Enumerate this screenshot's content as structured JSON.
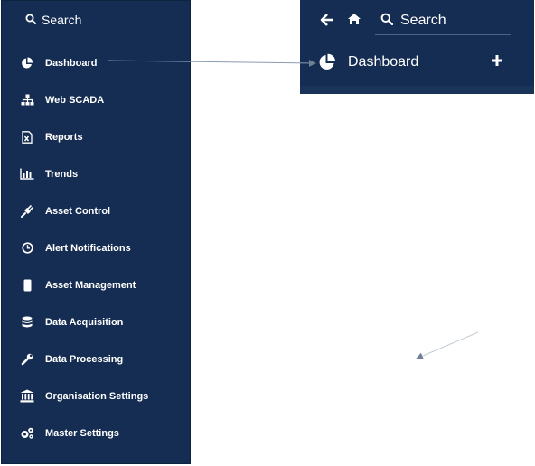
{
  "sidebar": {
    "search_label": "Search",
    "items": [
      {
        "label": "Dashboard",
        "icon": "pie-chart-icon"
      },
      {
        "label": "Web SCADA",
        "icon": "sitemap-icon"
      },
      {
        "label": "Reports",
        "icon": "excel-file-icon"
      },
      {
        "label": "Trends",
        "icon": "bar-chart-icon"
      },
      {
        "label": "Asset Control",
        "icon": "plug-icon"
      },
      {
        "label": "Alert Notifications",
        "icon": "clock-icon"
      },
      {
        "label": "Asset Management",
        "icon": "mobile-icon"
      },
      {
        "label": "Data Acquisition",
        "icon": "database-icon"
      },
      {
        "label": "Data Processing",
        "icon": "wrench-icon"
      },
      {
        "label": "Organisation Settings",
        "icon": "bank-icon"
      },
      {
        "label": "Master Settings",
        "icon": "cogs-icon"
      }
    ]
  },
  "header": {
    "search_label": "Search",
    "title": "Dashboard",
    "icons": [
      "back-arrow-icon",
      "home-icon",
      "search-icon",
      "pie-chart-icon",
      "plus-icon"
    ]
  },
  "colors": {
    "panel_bg": "#152d52",
    "text": "#ffffff",
    "divider": "#4b6387",
    "annotation_arrow": "#8a9bb0"
  }
}
